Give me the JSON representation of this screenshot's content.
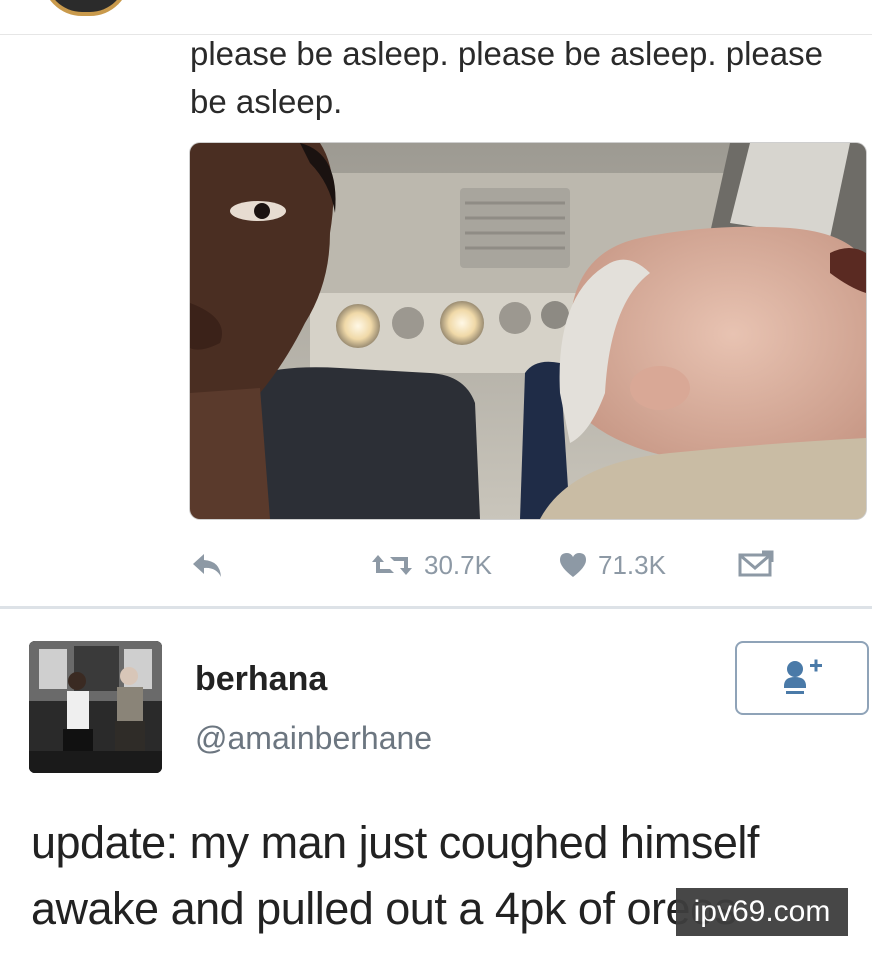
{
  "tweet1": {
    "text": "please be asleep. please be asleep. please be asleep.",
    "actions": {
      "reply_icon": "reply-icon",
      "retweet_icon": "retweet-icon",
      "retweet_count": "30.7K",
      "like_icon": "heart-icon",
      "like_count": "71.3K",
      "dm_icon": "envelope-icon"
    }
  },
  "tweet2": {
    "display_name": "berhana",
    "handle": "@amainberhane",
    "follow_icon": "add-user-icon",
    "text": "update: my man just coughed himself awake and pulled out a 4pk of oreos"
  },
  "watermark": "ipv69.com",
  "colors": {
    "icon_gray": "#8d99a5",
    "follow_icon": "#4a7aa8",
    "divider": "#dde2e7"
  }
}
